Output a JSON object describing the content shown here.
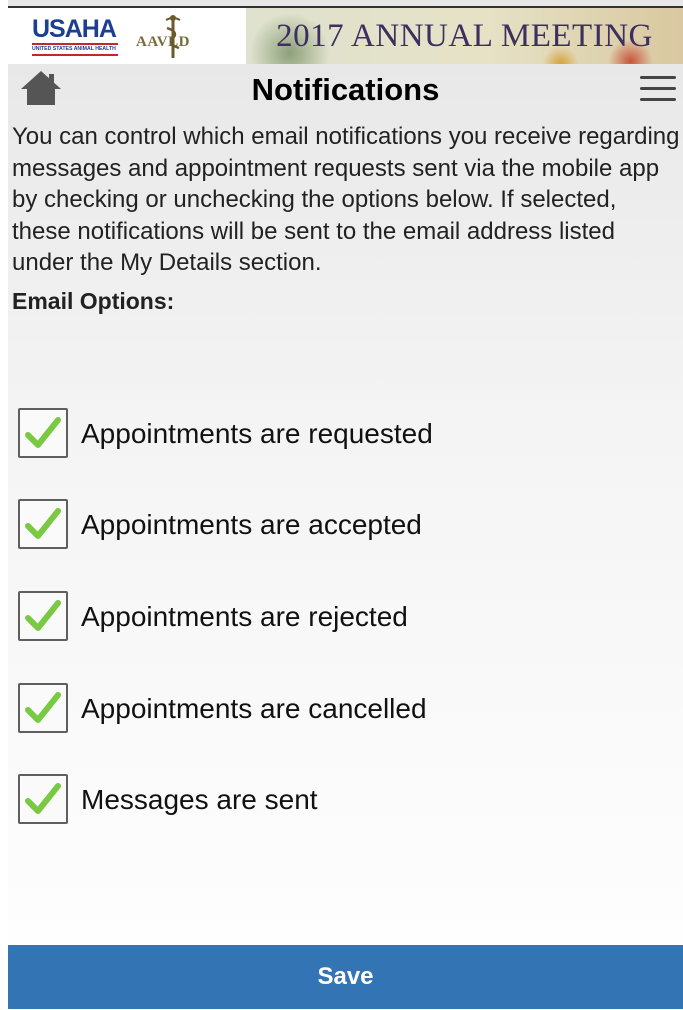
{
  "banner": {
    "usaha_logo": "USAHA",
    "usaha_subtitle": "UNITED STATES ANIMAL HEALTH",
    "aavld_logo": "AAVLD",
    "meeting_title": "2017 ANNUAL MEETING"
  },
  "header": {
    "title": "Notifications",
    "home_icon": "home-icon",
    "menu_icon": "hamburger-menu-icon"
  },
  "intro_text": "You can control which email notifications you receive regarding messages and appointment requests sent via the mobile app by checking or unchecking the options below. If selected, these notifications will be sent to the email address listed under the My Details section.",
  "email_options": {
    "label": "Email Options:",
    "items": [
      {
        "label": "Appointments are requested",
        "checked": true
      },
      {
        "label": "Appointments are accepted",
        "checked": true
      },
      {
        "label": "Appointments are rejected",
        "checked": true
      },
      {
        "label": "Appointments are cancelled",
        "checked": true
      },
      {
        "label": "Messages are sent",
        "checked": true
      }
    ]
  },
  "save_label": "Save",
  "colors": {
    "save_button": "#3374b5",
    "checkmark": "#7ac943"
  }
}
